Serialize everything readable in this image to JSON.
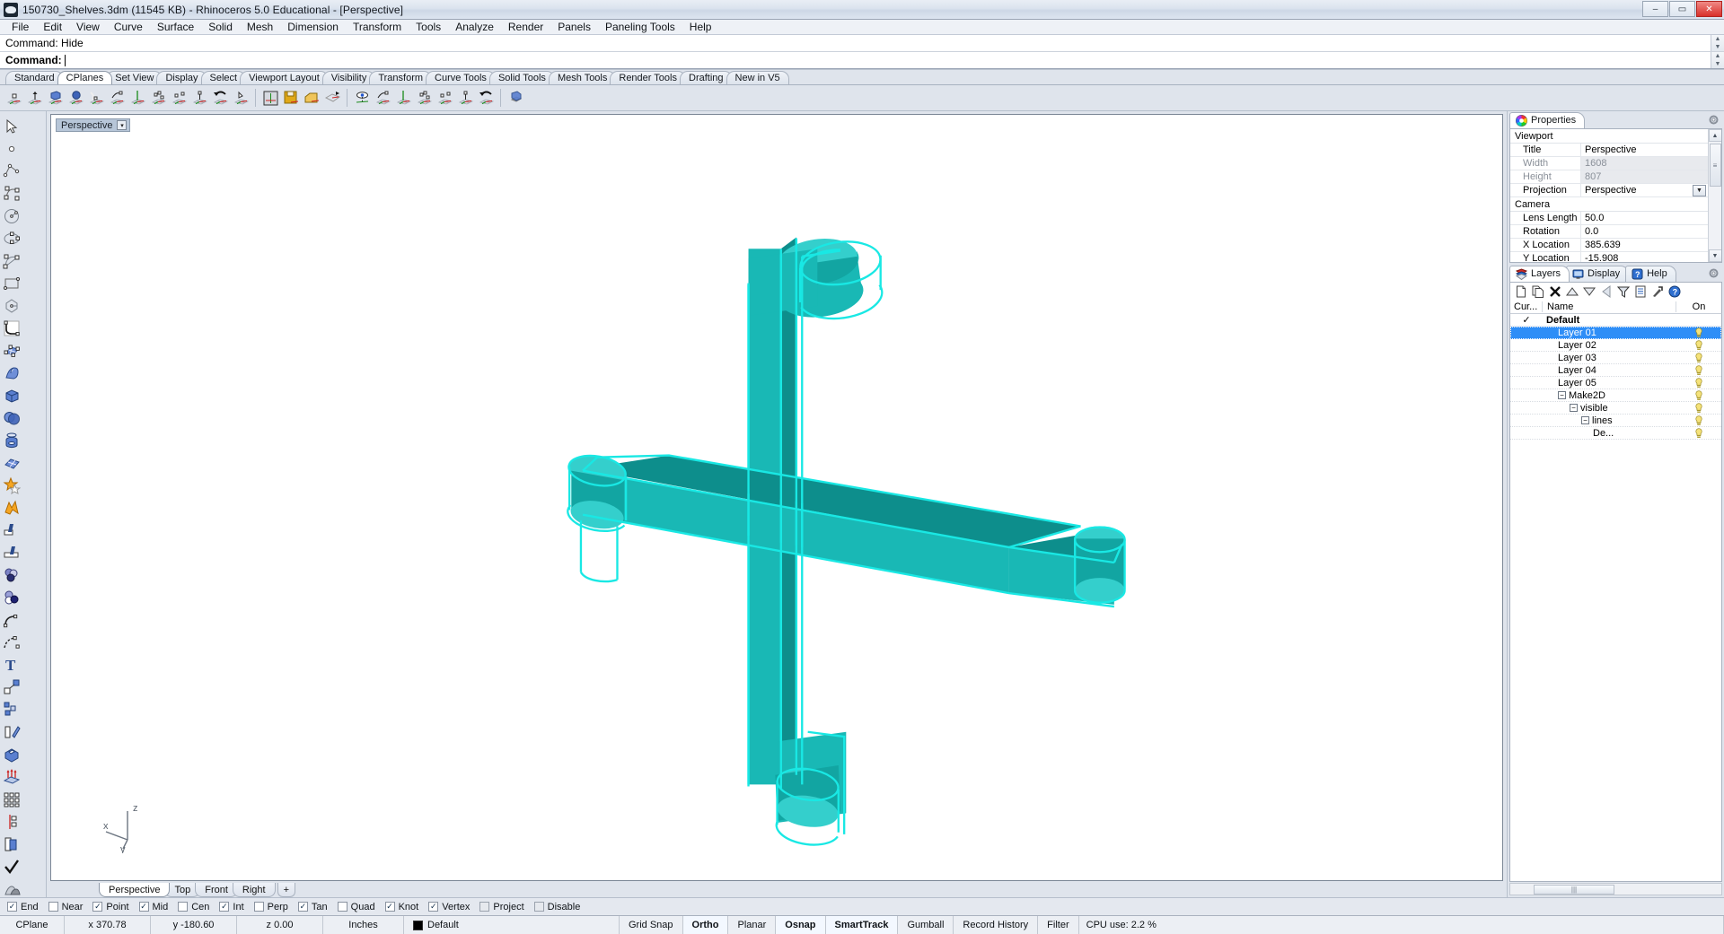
{
  "window": {
    "title": "150730_Shelves.3dm (11545 KB) - Rhinoceros 5.0 Educational - [Perspective]",
    "minimize": "–",
    "maximize": "▭",
    "close": "✕"
  },
  "menu": [
    {
      "label": "File"
    },
    {
      "label": "Edit"
    },
    {
      "label": "View"
    },
    {
      "label": "Curve"
    },
    {
      "label": "Surface"
    },
    {
      "label": "Solid"
    },
    {
      "label": "Mesh"
    },
    {
      "label": "Dimension"
    },
    {
      "label": "Transform"
    },
    {
      "label": "Tools"
    },
    {
      "label": "Analyze"
    },
    {
      "label": "Render"
    },
    {
      "label": "Panels"
    },
    {
      "label": "Paneling Tools"
    },
    {
      "label": "Help"
    }
  ],
  "command": {
    "history": "Command: Hide",
    "prompt_label": "Command:",
    "input_value": "",
    "scroll_up": "▲",
    "scroll_down": "▼"
  },
  "toolbar_tabs": [
    {
      "label": "Standard",
      "active": false
    },
    {
      "label": "CPlanes",
      "active": true
    },
    {
      "label": "Set View",
      "active": false
    },
    {
      "label": "Display",
      "active": false
    },
    {
      "label": "Select",
      "active": false
    },
    {
      "label": "Viewport Layout",
      "active": false
    },
    {
      "label": "Visibility",
      "active": false
    },
    {
      "label": "Transform",
      "active": false
    },
    {
      "label": "Curve Tools",
      "active": false
    },
    {
      "label": "Solid Tools",
      "active": false
    },
    {
      "label": "Mesh Tools",
      "active": false
    },
    {
      "label": "Render Tools",
      "active": false
    },
    {
      "label": "Drafting",
      "active": false
    },
    {
      "label": "New in V5",
      "active": false
    }
  ],
  "icon_toolbar": [
    "cplane-origin-icon",
    "cplane-elevation-icon",
    "cplane-object-icon",
    "cplane-surface-icon",
    "cplane-curve-icon",
    "cplane-perpendicular-curve-icon",
    "cplane-vertical-icon",
    "cplane-3point-icon",
    "cplane-rotate-icon",
    "cplane-set-z-icon",
    "cplane-undo-icon",
    "cplane-next-icon",
    "named-cplane-icon",
    "save-cplane-icon",
    "restore-cplane-icon",
    "cplane-world-top-icon",
    "cplane-view-icon",
    "cplane-to-view-icon",
    "cplane-rotate-x-icon",
    "cplane-rotate-y-icon",
    "cplane-rotate-z-icon",
    "cplane-prev-icon",
    "cplane-next2-icon",
    "cplane-universal-icon"
  ],
  "left_tools": [
    "selection-arrow-icon",
    "point-icon",
    "polyline-icon",
    "control-point-curve-icon",
    "circle-icon",
    "ellipse-icon",
    "arc-icon",
    "rectangle-icon",
    "polygon-icon",
    "curve-fillet-icon",
    "surface-points-icon",
    "surface-loft-icon",
    "box-icon",
    "sphere-icon",
    "cylinder-icon",
    "surface-grid-icon",
    "boolean-union-icon",
    "boolean-difference-icon",
    "split-icon",
    "trim-icon",
    "boolean-3spheres-icon",
    "boolean-2circles-icon",
    "fillet-curve-icon",
    "blend-curve-icon",
    "text-icon",
    "dimension-icon",
    "explode-icon",
    "join-icon",
    "extrude-icon",
    "array-up-icon",
    "grid-array-icon",
    "revolve-icon",
    "copy-icon",
    "check-icon",
    "render-mesh-icon",
    "paint-bucket-icon"
  ],
  "viewport": {
    "label": "Perspective",
    "dropdown_arrow": "▾",
    "axes": {
      "x": "x",
      "y": "y",
      "z": "z"
    },
    "model_colors": {
      "edge": "#19e8e4",
      "front_face": "#19b5b2",
      "top_face": "#0d8a88",
      "side_face": "#2bc8c6",
      "background": "#ffffff"
    },
    "tabs": [
      {
        "label": "Perspective",
        "active": true
      },
      {
        "label": "Top",
        "active": false
      },
      {
        "label": "Front",
        "active": false
      },
      {
        "label": "Right",
        "active": false
      },
      {
        "label": "+",
        "active": false
      }
    ]
  },
  "properties_panel": {
    "tab_label": "Properties",
    "tab_icon": "color-wheel-icon",
    "gear_icon": "gear-icon",
    "groups": [
      {
        "name": "Viewport",
        "rows": [
          {
            "key": "Title",
            "value": "Perspective",
            "dim": false,
            "dropdown": false
          },
          {
            "key": "Width",
            "value": "1608",
            "dim": true,
            "dropdown": false
          },
          {
            "key": "Height",
            "value": "807",
            "dim": true,
            "dropdown": false
          },
          {
            "key": "Projection",
            "value": "Perspective",
            "dim": false,
            "dropdown": true
          }
        ]
      },
      {
        "name": "Camera",
        "rows": [
          {
            "key": "Lens Length",
            "value": "50.0",
            "dim": false,
            "dropdown": false
          },
          {
            "key": "Rotation",
            "value": "0.0",
            "dim": false,
            "dropdown": false
          },
          {
            "key": "X Location",
            "value": "385.639",
            "dim": false,
            "dropdown": false
          },
          {
            "key": "Y Location",
            "value": "-15.908",
            "dim": false,
            "dropdown": false
          }
        ]
      }
    ]
  },
  "layers_panel": {
    "tabs": [
      {
        "label": "Layers",
        "icon": "layers-icon",
        "active": true
      },
      {
        "label": "Display",
        "icon": "monitor-icon",
        "active": false
      },
      {
        "label": "Help",
        "icon": "help-icon",
        "active": false
      }
    ],
    "gear_icon": "gear-icon",
    "toolbar": [
      "new-layer-icon",
      "duplicate-layer-icon",
      "delete-layer-icon",
      "move-up-icon",
      "move-down-icon",
      "move-left-icon",
      "filter-icon",
      "properties-icon",
      "tools-icon",
      "help-icon"
    ],
    "columns": {
      "current": "Cur...",
      "name": "Name",
      "on": "On"
    },
    "rows": [
      {
        "current": "✓",
        "name": "Default",
        "indent": 0,
        "toggle": null,
        "on": false,
        "selected": false,
        "bold": true
      },
      {
        "current": "",
        "name": "Layer 01",
        "indent": 1,
        "toggle": null,
        "on": true,
        "selected": true,
        "bold": false
      },
      {
        "current": "",
        "name": "Layer 02",
        "indent": 1,
        "toggle": null,
        "on": true,
        "selected": false,
        "bold": false
      },
      {
        "current": "",
        "name": "Layer 03",
        "indent": 1,
        "toggle": null,
        "on": true,
        "selected": false,
        "bold": false
      },
      {
        "current": "",
        "name": "Layer 04",
        "indent": 1,
        "toggle": null,
        "on": true,
        "selected": false,
        "bold": false
      },
      {
        "current": "",
        "name": "Layer 05",
        "indent": 1,
        "toggle": null,
        "on": true,
        "selected": false,
        "bold": false
      },
      {
        "current": "",
        "name": "Make2D",
        "indent": 1,
        "toggle": "−",
        "on": true,
        "selected": false,
        "bold": false
      },
      {
        "current": "",
        "name": "visible",
        "indent": 2,
        "toggle": "−",
        "on": true,
        "selected": false,
        "bold": false
      },
      {
        "current": "",
        "name": "lines",
        "indent": 3,
        "toggle": "−",
        "on": true,
        "selected": false,
        "bold": false
      },
      {
        "current": "",
        "name": "De...",
        "indent": 4,
        "toggle": null,
        "on": true,
        "selected": false,
        "bold": false
      }
    ]
  },
  "osnap": [
    {
      "label": "End",
      "checked": true,
      "disabled": false
    },
    {
      "label": "Near",
      "checked": false,
      "disabled": false
    },
    {
      "label": "Point",
      "checked": true,
      "disabled": false
    },
    {
      "label": "Mid",
      "checked": true,
      "disabled": false
    },
    {
      "label": "Cen",
      "checked": false,
      "disabled": false
    },
    {
      "label": "Int",
      "checked": true,
      "disabled": false
    },
    {
      "label": "Perp",
      "checked": false,
      "disabled": false
    },
    {
      "label": "Tan",
      "checked": true,
      "disabled": false
    },
    {
      "label": "Quad",
      "checked": false,
      "disabled": false
    },
    {
      "label": "Knot",
      "checked": true,
      "disabled": false
    },
    {
      "label": "Vertex",
      "checked": true,
      "disabled": false
    },
    {
      "label": "Project",
      "checked": false,
      "disabled": true
    },
    {
      "label": "Disable",
      "checked": false,
      "disabled": true
    }
  ],
  "statusbar": {
    "cplane": "CPlane",
    "x": "x 370.78",
    "y": "y -180.60",
    "z": "z 0.00",
    "units": "Inches",
    "layer": "Default",
    "layer_color": "#000000",
    "toggles": [
      {
        "label": "Grid Snap",
        "on": false
      },
      {
        "label": "Ortho",
        "on": true
      },
      {
        "label": "Planar",
        "on": false
      },
      {
        "label": "Osnap",
        "on": true
      },
      {
        "label": "SmartTrack",
        "on": true
      },
      {
        "label": "Gumball",
        "on": false
      },
      {
        "label": "Record History",
        "on": false
      },
      {
        "label": "Filter",
        "on": false
      }
    ],
    "cpu": "CPU use: 2.2 %"
  }
}
